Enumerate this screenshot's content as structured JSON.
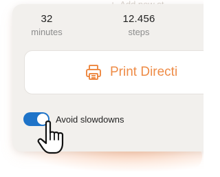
{
  "background_hint": {
    "icon": "plus-icon",
    "text": "Add new st"
  },
  "stats": {
    "minutes": {
      "value": "32",
      "label": "minutes"
    },
    "steps": {
      "value": "12.456",
      "label": "steps"
    }
  },
  "print_button": {
    "icon": "printer-icon",
    "label": "Print Directi"
  },
  "avoid_slowdowns": {
    "label": "Avoid slowdowns",
    "state": "on"
  },
  "colors": {
    "accent_orange": "#ee8b46",
    "toggle_blue": "#1e73c8",
    "card_background": "#f2f0ed"
  },
  "cursor": {
    "icon": "hand-pointer-icon"
  }
}
